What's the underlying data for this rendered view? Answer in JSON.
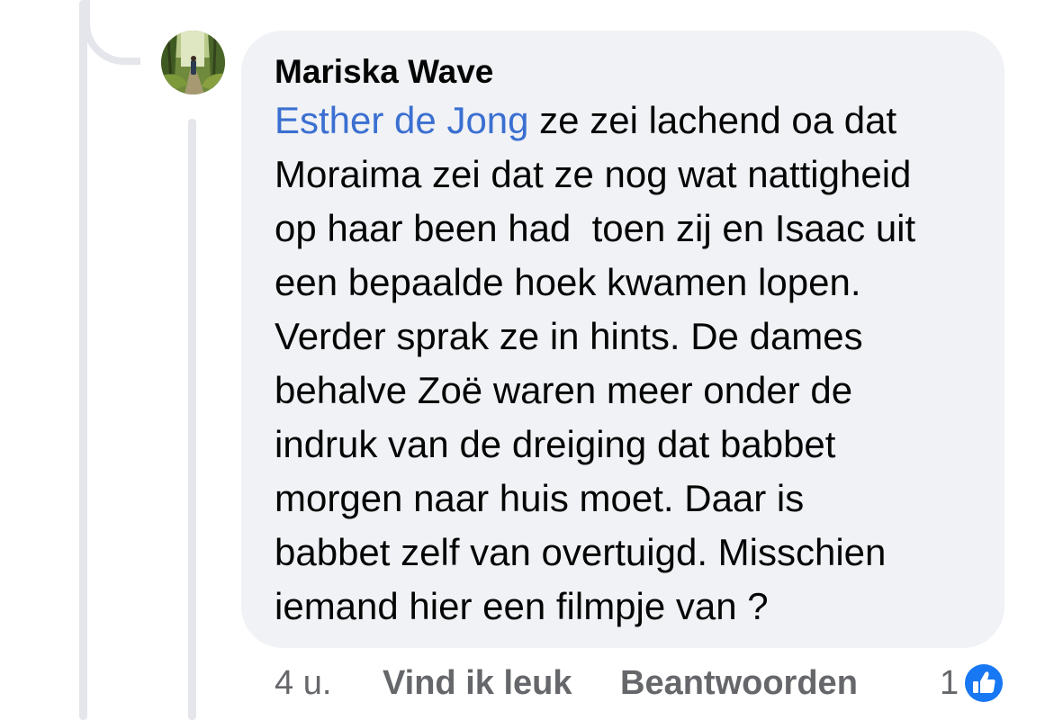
{
  "comment": {
    "author": "Mariska Wave",
    "mention": "Esther de Jong",
    "lines": [
      " ze zei lachend oa dat",
      "Moraima zei dat ze nog wat nattigheid",
      "op haar been had  toen zij en Isaac uit",
      "een bepaalde hoek kwamen lopen.",
      "Verder sprak ze in hints. De dames",
      "behalve Zoë waren meer onder de",
      "indruk van de dreiging dat babbet",
      "morgen naar huis moet. Daar is",
      "babbet zelf van overtuigd. Misschien",
      "iemand hier een filmpje van ?"
    ]
  },
  "actions": {
    "time": "4 u.",
    "like_label": "Vind ik leuk",
    "reply_label": "Beantwoorden"
  },
  "reactions": {
    "count": "1",
    "icon": "like-thumbs-up-icon",
    "color": "#1877f2"
  },
  "colors": {
    "bubble": "#f0f2f5",
    "mention": "#3b6fd1",
    "text": "#050505",
    "muted": "#65676b",
    "thread_line": "#e4e6eb"
  }
}
